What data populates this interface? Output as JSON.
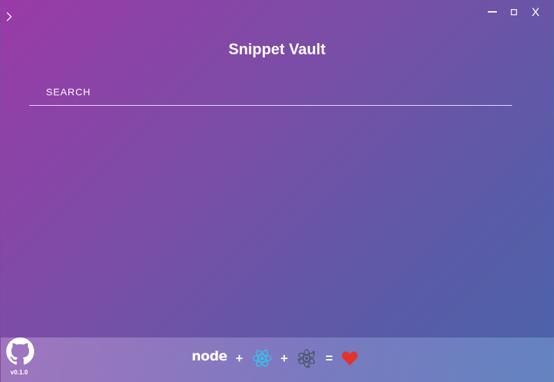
{
  "app": {
    "title": "Snippet Vault"
  },
  "window_controls": {
    "close_label": "X"
  },
  "search": {
    "placeholder": "SEARCH",
    "value": ""
  },
  "footer": {
    "version": "v0.1.0",
    "node_logo_text": "node",
    "plus_1": "+",
    "plus_2": "+",
    "equals": "=",
    "icons": [
      "github-icon",
      "nodejs-logo-icon",
      "react-logo-icon",
      "electron-logo-icon",
      "heart-icon"
    ]
  },
  "colors": {
    "react": "#2fc6f0",
    "heart": "#e2342b",
    "node_dot": "#6aa84f",
    "electron": "#4a5366"
  }
}
